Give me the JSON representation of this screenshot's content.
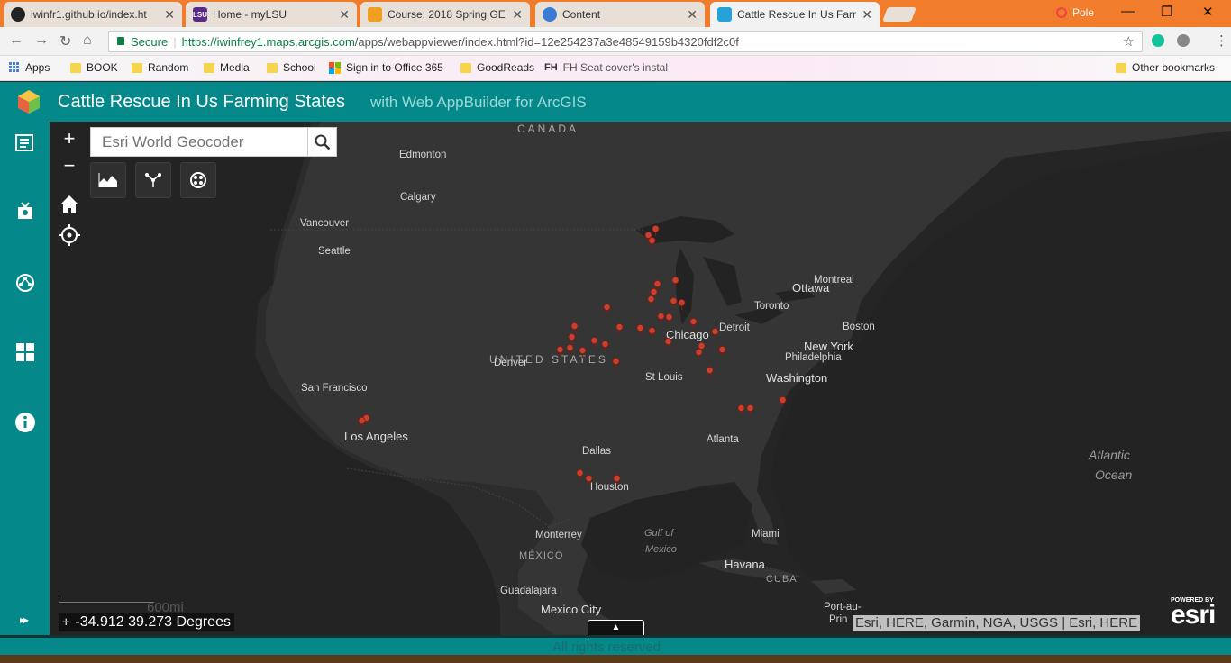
{
  "browser": {
    "tabs": [
      {
        "title": "iwinfr1.github.io/index.ht",
        "favicon": "github-icon",
        "color": "#222222"
      },
      {
        "title": "Home - myLSU",
        "favicon": "lsu-icon",
        "color": "#5b2a86"
      },
      {
        "title": "Course: 2018 Spring GEO",
        "favicon": "moodle-icon",
        "color": "#f0a020"
      },
      {
        "title": "Content",
        "favicon": "globe-icon",
        "color": "#3a7bd5"
      },
      {
        "title": "Cattle Rescue In Us Farm",
        "favicon": "webappbuilder-icon",
        "color": "#27a2d8"
      }
    ],
    "profile": "Pole",
    "secure_label": "Secure",
    "url_host": "https://iwinfrey1.maps.arcgis.com",
    "url_path": "/apps/webappviewer/index.html?id=12e254237a3e48549159b4320fdf2c0f",
    "bookmarks": [
      {
        "label": "Apps",
        "icon": "apps-grid-icon"
      },
      {
        "label": "BOOK",
        "icon": "folder-icon"
      },
      {
        "label": "Random",
        "icon": "folder-icon"
      },
      {
        "label": "Media",
        "icon": "folder-icon"
      },
      {
        "label": "School",
        "icon": "folder-icon"
      },
      {
        "label": "Sign in to Office 365",
        "icon": "microsoft-icon"
      },
      {
        "label": "GoodReads",
        "icon": "folder-icon"
      },
      {
        "label": "FH Seat cover's instal",
        "icon": "fh-icon"
      }
    ],
    "other_bookmarks": "Other bookmarks"
  },
  "app": {
    "title": "Cattle Rescue In Us Farming States",
    "subtitle": "with Web AppBuilder for ArcGIS",
    "accent": "#04888a",
    "sidebar_icons": [
      "layer-list-icon",
      "legend-icon",
      "basemap-gallery-icon",
      "widgets-icon",
      "about-icon"
    ]
  },
  "map": {
    "search_placeholder": "Esri World Geocoder",
    "zoom_in": "+",
    "zoom_out": "−",
    "tools": [
      "elevation-profile-icon",
      "directions-icon",
      "analysis-icon"
    ],
    "scale_label": "600mi",
    "coordinates": "-34.912 39.273 Degrees",
    "attribution": "Esri, HERE, Garmin, NGA, USGS | Esri, HERE",
    "powered_by": "POWERED BY",
    "esri": "esri",
    "places": {
      "canada": "CANADA",
      "united_states": "UNITED STATES",
      "edmonton": "Edmonton",
      "calgary": "Calgary",
      "vancouver": "Vancouver",
      "seattle": "Seattle",
      "ottawa": "Ottawa",
      "montreal": "Montreal",
      "toronto": "Toronto",
      "boston": "Boston",
      "detroit": "Detroit",
      "chicago": "Chicago",
      "new_york": "New York",
      "philadelphia": "Philadelphia",
      "washington": "Washington",
      "denver": "Denver",
      "st_louis": "St Louis",
      "san_francisco": "San Francisco",
      "los_angeles": "Los Angeles",
      "atlanta": "Atlanta",
      "dallas": "Dallas",
      "houston": "Houston",
      "atlantic": "Atlantic",
      "ocean": "Ocean",
      "gulf_of": "Gulf of",
      "mexico_gulf": "Mexico",
      "monterrey": "Monterrey",
      "mexico_country": "MÉXICO",
      "miami": "Miami",
      "havana": "Havana",
      "cuba": "CUBA",
      "guadalajara": "Guadalajara",
      "mexico_city": "Mexico City",
      "port_au": "Port-au-",
      "prin": "Prin"
    }
  },
  "footer": {
    "text": "All rights reserved"
  }
}
